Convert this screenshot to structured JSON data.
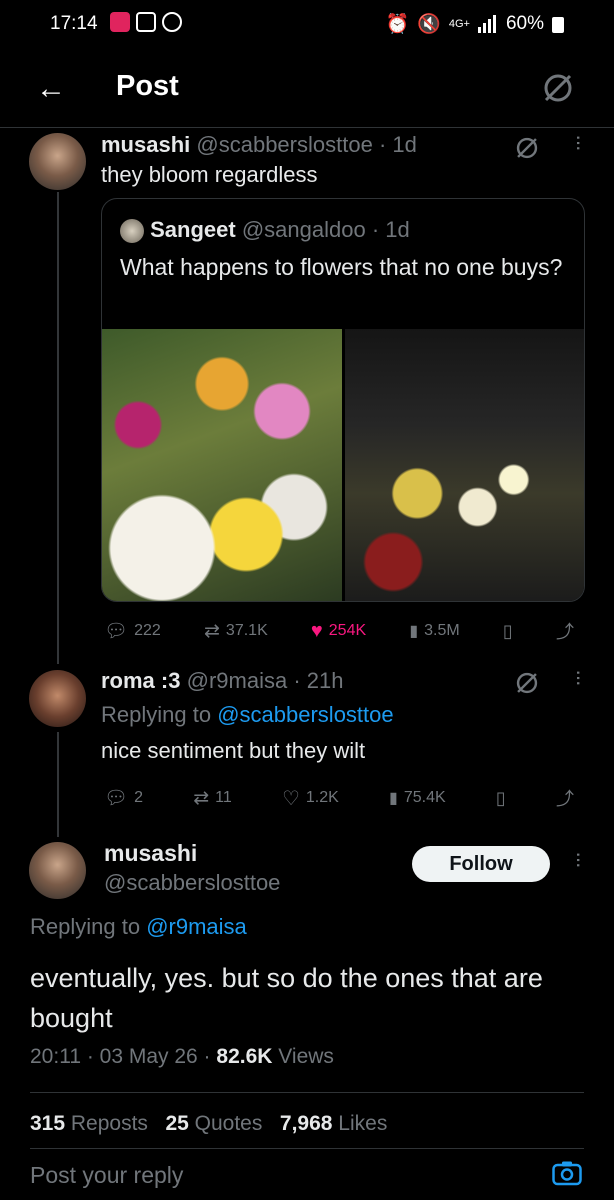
{
  "status_bar": {
    "time": "17:14",
    "battery": "60%",
    "network": "4G+"
  },
  "header": {
    "title": "Post",
    "back_icon": "arrow-left-icon",
    "grok_icon": "grok-icon"
  },
  "reply1": {
    "name": "musashi",
    "handle": "@scabberslosttoe",
    "time": "· 1d",
    "text": "they bloom regardless",
    "quote": {
      "name": "Sangeet",
      "handle": "@sangaldoo",
      "time": "· 1d",
      "text": "What happens to flowers that no one buys?"
    },
    "stats": {
      "replies": "222",
      "reposts": "37.1K",
      "likes": "254K",
      "views": "3.5M"
    }
  },
  "reply2": {
    "name": "roma :3",
    "handle": "@r9maisa",
    "time": "· 21h",
    "replying_prefix": "Replying to",
    "replying_to": "@scabberslosttoe",
    "text": "nice sentiment but they wilt",
    "stats": {
      "replies": "2",
      "reposts": "11",
      "likes": "1.2K",
      "views": "75.4K"
    }
  },
  "main_post": {
    "name": "musashi",
    "handle": "@scabberslosttoe",
    "follow_label": "Follow",
    "replying_prefix": "Replying to",
    "replying_to": "@r9maisa",
    "text": "eventually, yes. but so do the ones that are bought",
    "timestamp": "20:11 · 03 May 26 ·",
    "views_count": "82.6K",
    "views_label": "Views",
    "reposts_count": "315",
    "reposts_label": "Reposts",
    "quotes_count": "25",
    "quotes_label": "Quotes",
    "likes_count": "7,968",
    "likes_label": "Likes"
  },
  "reply_box": {
    "placeholder": "Post your reply"
  },
  "colors": {
    "background": "#000000",
    "link": "#1d9bf0",
    "like": "#f91880",
    "muted": "#71767b"
  }
}
